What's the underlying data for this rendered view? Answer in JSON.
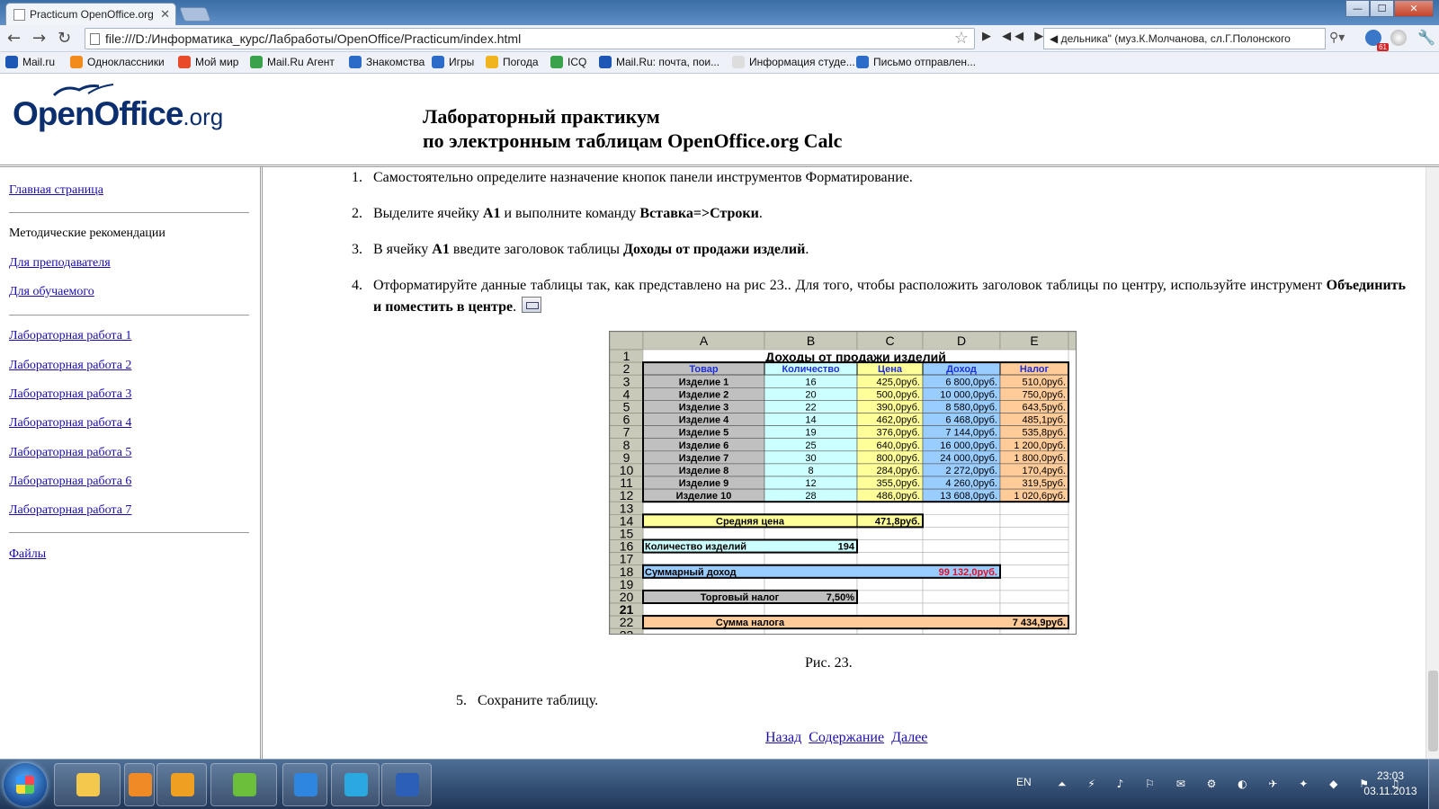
{
  "browser": {
    "tab_title": "Practicum OpenOffice.org",
    "tab_close": "✕",
    "address": "file:///D:/Информатика_курс/Лабработы/OpenOffice/Practicum/index.html",
    "media_controls": "▶ ◀◀ ▶▶",
    "search_text": "◀ дельника\" (муз.К.Молчанова, сл.Г.Полонского",
    "ext_badge": "61",
    "window_buttons": {
      "minimize": "—",
      "maximize": "☐",
      "close": "✕"
    },
    "bookmarks": [
      {
        "label": "Mail.ru",
        "color": "#1c57b5"
      },
      {
        "label": "Одноклассники",
        "color": "#f28a1c"
      },
      {
        "label": "Мой мир",
        "color": "#e84a2a"
      },
      {
        "label": "Mail.Ru Агент",
        "color": "#3aa24a"
      },
      {
        "label": "Знакомства",
        "color": "#2b6cc8"
      },
      {
        "label": "Игры",
        "color": "#2b6cc8"
      },
      {
        "label": "Погода",
        "color": "#f0b41c"
      },
      {
        "label": "ICQ",
        "color": "#3aa24a"
      },
      {
        "label": "Mail.Ru: почта, пои...",
        "color": "#1c57b5"
      },
      {
        "label": "Информация студе...",
        "color": "#dddddd"
      },
      {
        "label": "Письмо отправлен...",
        "color": "#2b6cc8"
      }
    ]
  },
  "header": {
    "logo_text": "OpenOffice",
    "logo_suffix": ".org",
    "title_line1": "Лабораторный практикум",
    "title_line2": "по электронным таблицам OpenOffice.org Calc"
  },
  "sidebar": {
    "home": "Главная страница",
    "methods": "Методические рекомендации",
    "teacher": "Для преподавателя",
    "student": "Для обучаемого",
    "labs": [
      "Лабораторная работа 1",
      "Лабораторная работа 2",
      "Лабораторная работа 3",
      "Лабораторная работа 4",
      "Лабораторная работа 5",
      "Лабораторная работа 6",
      "Лабораторная работа 7"
    ],
    "files": "Файлы"
  },
  "content": {
    "step1": {
      "num": "1.",
      "text": "Самостоятельно определите назначение кнопок панели инструментов Форматирование."
    },
    "step2": {
      "num": "2.",
      "a": "Выделите ячейку ",
      "b": "A1",
      "c": " и выполните команду ",
      "d": "Вставка=>Строки",
      "e": "."
    },
    "step3": {
      "num": "3.",
      "a": "В ячейку ",
      "b": "A1",
      "c": " введите заголовок таблицы ",
      "d": "Доходы от продажи изделий",
      "e": "."
    },
    "step4": {
      "num": "4.",
      "a": "Отформатируйте данные таблицы так, как представлено на рис 23.. Для того, чтобы расположить заголовок таблицы по центру, используйте инструмент ",
      "b": "Объединить и поместить в центре",
      "c": "."
    },
    "caption": "Рис. 23.",
    "step5": {
      "num": "5.",
      "text": "Сохраните таблицу."
    },
    "pager": {
      "back": "Назад",
      "contents": "Содержание",
      "next": "Далее"
    }
  },
  "sheet": {
    "columns": [
      "A",
      "B",
      "C",
      "D",
      "E"
    ],
    "title": "Доходы от продажи изделий",
    "headers": [
      "Товар",
      "Количество",
      "Цена",
      "Доход",
      "Налог"
    ],
    "rows": [
      [
        "Изделие 1",
        "16",
        "425,0руб.",
        "6 800,0руб.",
        "510,0руб."
      ],
      [
        "Изделие 2",
        "20",
        "500,0руб.",
        "10 000,0руб.",
        "750,0руб."
      ],
      [
        "Изделие 3",
        "22",
        "390,0руб.",
        "8 580,0руб.",
        "643,5руб."
      ],
      [
        "Изделие 4",
        "14",
        "462,0руб.",
        "6 468,0руб.",
        "485,1руб."
      ],
      [
        "Изделие 5",
        "19",
        "376,0руб.",
        "7 144,0руб.",
        "535,8руб."
      ],
      [
        "Изделие 6",
        "25",
        "640,0руб.",
        "16 000,0руб.",
        "1 200,0руб."
      ],
      [
        "Изделие 7",
        "30",
        "800,0руб.",
        "24 000,0руб.",
        "1 800,0руб."
      ],
      [
        "Изделие 8",
        "8",
        "284,0руб.",
        "2 272,0руб.",
        "170,4руб."
      ],
      [
        "Изделие 9",
        "12",
        "355,0руб.",
        "4 260,0руб.",
        "319,5руб."
      ],
      [
        "Изделие 10",
        "28",
        "486,0руб.",
        "13 608,0руб.",
        "1 020,6руб."
      ]
    ],
    "avg_label": "Средняя цена",
    "avg_value": "471,8руб.",
    "count_label": "Количество изделий",
    "count_value": "194",
    "income_label": "Суммарный доход",
    "income_value": "99 132,0руб.",
    "tax_label": "Торговый налог",
    "tax_value": "7,50%",
    "taxsum_label": "Сумма налога",
    "taxsum_value": "7 434,9руб.",
    "colors": {
      "grid_header": "#c9c9b9",
      "col_a": "#c0c0c0",
      "col_b": "#ccffff",
      "col_c": "#ffff99",
      "col_d": "#99ccff",
      "col_e": "#ffcc99",
      "header_text": "#1f2fd6",
      "income_value": "#e0102a"
    }
  },
  "taskbar": {
    "lang": "EN",
    "tray_icons": "⏶ ⚡ ♪ ⚐ ✉ ⚙ ◐ ✈ ✦ ◆ ⚑ ♫",
    "time": "23:03",
    "date": "03.11.2013",
    "apps": [
      {
        "name": "explorer",
        "color": "#f2c94c"
      },
      {
        "name": "media-player",
        "color": "#f08a24"
      },
      {
        "name": "mail-agent",
        "color": "#f0a020"
      },
      {
        "name": "chrome",
        "color": "#6bbf3a"
      },
      {
        "name": "internet-explorer",
        "color": "#2f86e0"
      },
      {
        "name": "skype",
        "color": "#2aa8e0"
      },
      {
        "name": "word",
        "color": "#2b5fb8"
      }
    ]
  }
}
